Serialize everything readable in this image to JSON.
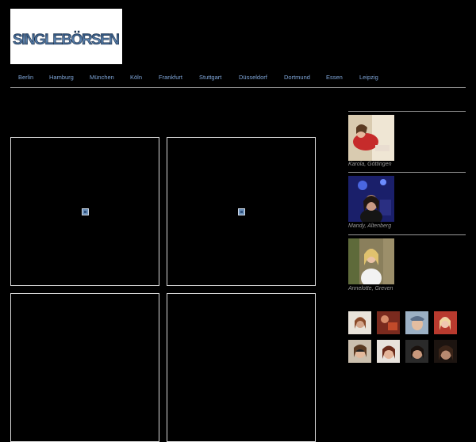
{
  "site": {
    "logo_text": "SINGLEBÖRSEN"
  },
  "nav": {
    "items": [
      {
        "label": "Berlin"
      },
      {
        "label": "Hamburg"
      },
      {
        "label": "München"
      },
      {
        "label": "Köln"
      },
      {
        "label": "Frankfurt"
      },
      {
        "label": "Stuttgart"
      },
      {
        "label": "Düsseldorf"
      },
      {
        "label": "Dortmund"
      },
      {
        "label": "Essen"
      },
      {
        "label": "Leipzig"
      }
    ]
  },
  "sidebar": {
    "profiles": [
      {
        "caption": "Karola, Göttingen"
      },
      {
        "caption": "Mandy, Altenberg"
      },
      {
        "caption": "Annelotte, Greven"
      }
    ]
  },
  "colors": {
    "background": "#000000",
    "nav_link": "#7fa6d9",
    "caption": "#9a9a9a",
    "tile_border": "#d8d8d8"
  }
}
